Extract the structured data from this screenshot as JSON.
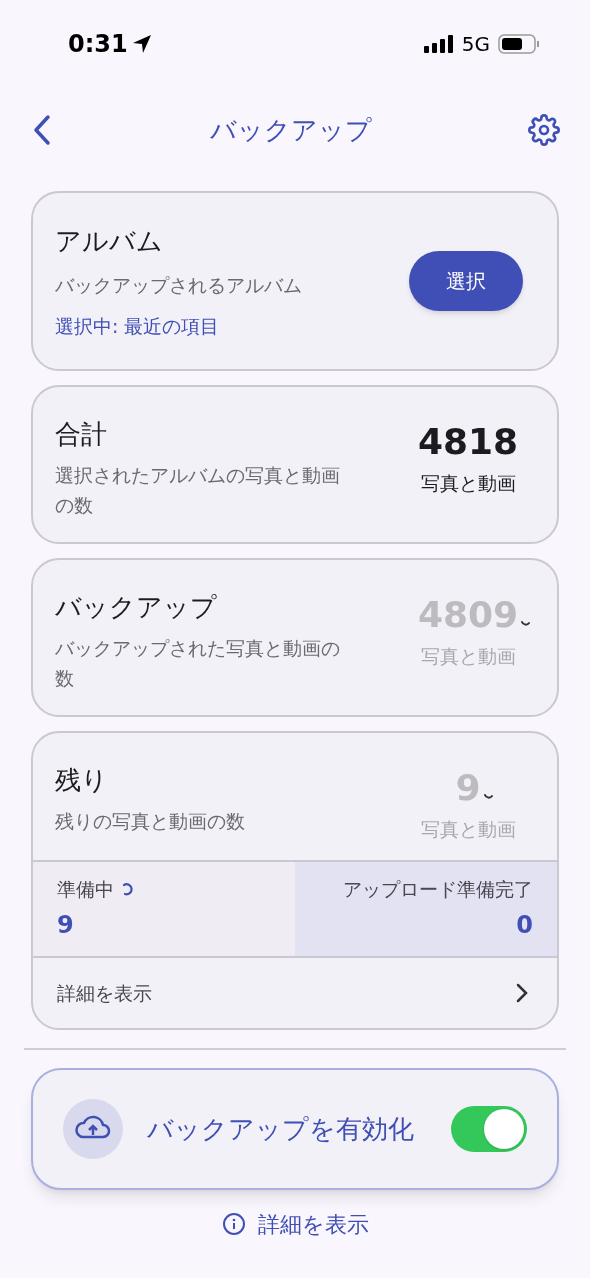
{
  "status_bar": {
    "time": "0:31",
    "network": "5G"
  },
  "header": {
    "title": "バックアップ"
  },
  "album_card": {
    "title": "アルバム",
    "subtitle": "バックアップされるアルバム",
    "selection": "選択中: 最近の項目",
    "button": "選択"
  },
  "stat_cards": [
    {
      "title": "合計",
      "subtitle": "選択されたアルバムの写真と動画の数",
      "count": "4818",
      "unit": "写真と動画",
      "loading": false
    },
    {
      "title": "バックアップ",
      "subtitle": "バックアップされた写真と動画の数",
      "count": "4809",
      "unit": "写真と動画",
      "loading": true
    },
    {
      "title": "残り",
      "subtitle": "残りの写真と動画の数",
      "count": "9",
      "unit": "写真と動画",
      "loading": true
    }
  ],
  "queue": [
    {
      "label": "準備中",
      "value": "9",
      "loading": true
    },
    {
      "label": "アップロード準備完了",
      "value": "0",
      "loading": false
    }
  ],
  "details_link": "詳細を表示",
  "enable_backup": {
    "label": "バックアップを有効化",
    "on": true
  },
  "footer_link": "詳細を表示"
}
